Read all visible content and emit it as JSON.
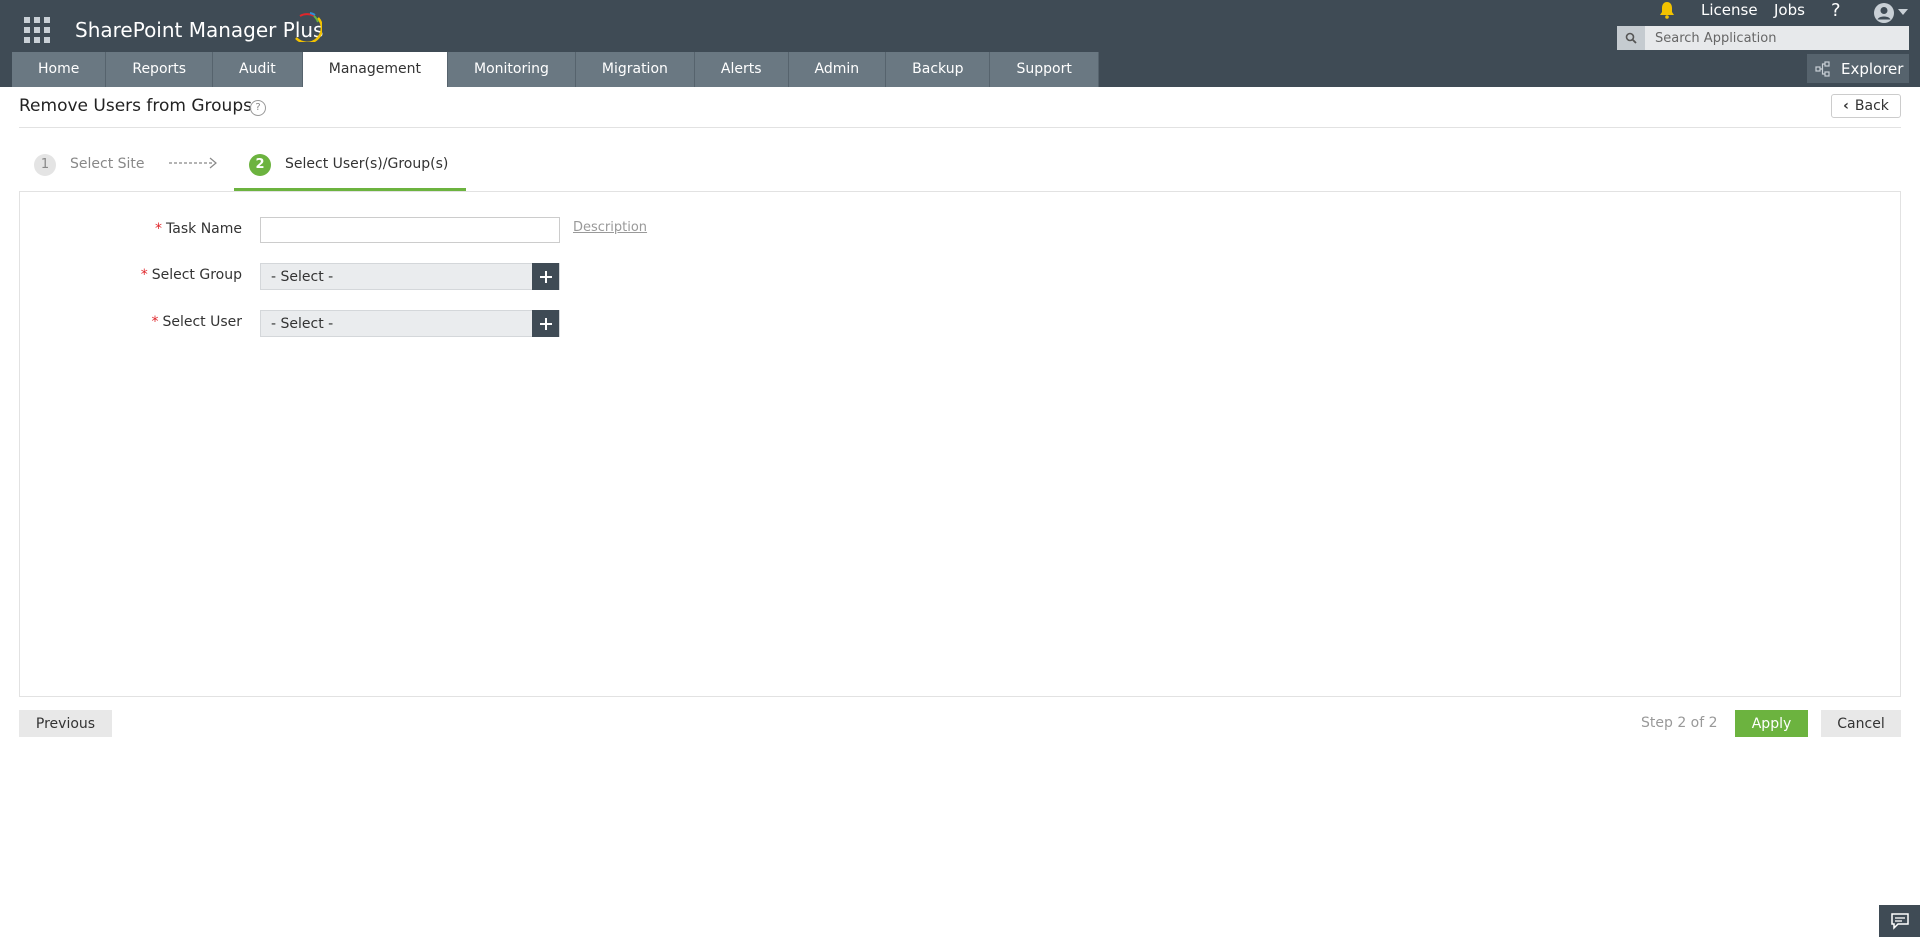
{
  "app": {
    "brand": "SharePoint Manager Plus"
  },
  "header": {
    "links": {
      "license": "License",
      "jobs": "Jobs",
      "help": "?"
    },
    "search": {
      "placeholder": "Search Application"
    },
    "explorer_label": "Explorer"
  },
  "nav": {
    "tabs": [
      {
        "label": "Home"
      },
      {
        "label": "Reports"
      },
      {
        "label": "Audit"
      },
      {
        "label": "Management",
        "active": true
      },
      {
        "label": "Monitoring"
      },
      {
        "label": "Migration"
      },
      {
        "label": "Alerts"
      },
      {
        "label": "Admin"
      },
      {
        "label": "Backup"
      },
      {
        "label": "Support"
      }
    ]
  },
  "page": {
    "title": "Remove Users from Groups",
    "help": "?",
    "back_label": "Back"
  },
  "steps": [
    {
      "number": "1",
      "label": "Select Site"
    },
    {
      "number": "2",
      "label": "Select User(s)/Group(s)",
      "active": true
    }
  ],
  "form": {
    "task_name": {
      "label": "Task Name",
      "value": "",
      "description_link": "Description"
    },
    "select_group": {
      "label": "Select Group",
      "value": "- Select -"
    },
    "select_user": {
      "label": "Select User",
      "value": "- Select -"
    },
    "required_mark": "*"
  },
  "footer": {
    "previous_label": "Previous",
    "step_count": "Step 2 of 2",
    "apply_label": "Apply",
    "cancel_label": "Cancel"
  },
  "colors": {
    "header_bg": "#3f4b55",
    "tab_bg": "#6a7882",
    "accent_green": "#6cb33f",
    "required_red": "#e0262b",
    "bell_yellow": "#f2c200"
  }
}
